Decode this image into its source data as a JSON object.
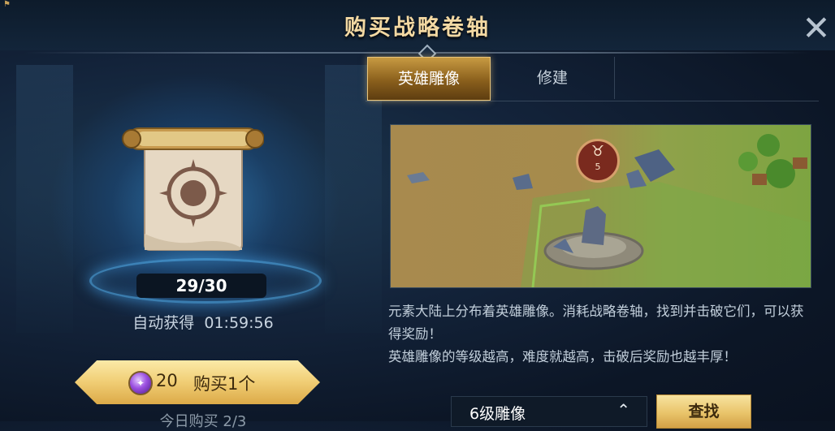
{
  "header": {
    "title": "购买战略卷轴",
    "close_icon": "close-icon"
  },
  "left": {
    "item_icon": "strategy-scroll-icon",
    "count": "29/30",
    "auto_label": "自动获得",
    "auto_timer": "01:59:56",
    "buy": {
      "currency_icon": "purple-gem-icon",
      "price": "20",
      "label": "购买1个"
    },
    "daily_label": "今日购买 2/3"
  },
  "tabs": [
    {
      "label": "英雄雕像",
      "active": true
    },
    {
      "label": "修建",
      "active": false
    }
  ],
  "map": {
    "marker_icon": "bull-skull-icon",
    "marker_level": "5"
  },
  "description": {
    "line1": "元素大陆上分布着英雄雕像。消耗战略卷轴，找到并击破它们，可以获得奖励！",
    "line2": "英雄雕像的等级越高，难度就越高，击破后奖励也越丰厚！"
  },
  "footer": {
    "level_select_value": "6级雕像",
    "level_select_icon": "chevron-up-icon",
    "find_label": "查找"
  },
  "colors": {
    "accent_gold": "#f0cd74",
    "title_gold": "#f3d9a3",
    "background": "#13233a"
  }
}
